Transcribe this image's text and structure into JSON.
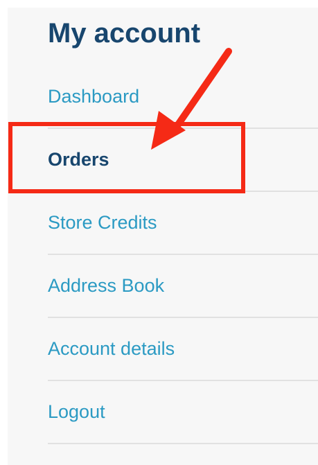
{
  "sidebar": {
    "title": "My account",
    "items": [
      {
        "label": "Dashboard",
        "active": false
      },
      {
        "label": "Orders",
        "active": true
      },
      {
        "label": "Store Credits",
        "active": false
      },
      {
        "label": "Address Book",
        "active": false
      },
      {
        "label": "Account details",
        "active": false
      },
      {
        "label": "Logout",
        "active": false
      }
    ]
  },
  "colors": {
    "title": "#18466e",
    "link": "#2b9ac3",
    "active_link": "#18466e",
    "highlight": "#f52a16",
    "panel_background": "#f7f7f7",
    "divider": "#e1e1e1"
  }
}
